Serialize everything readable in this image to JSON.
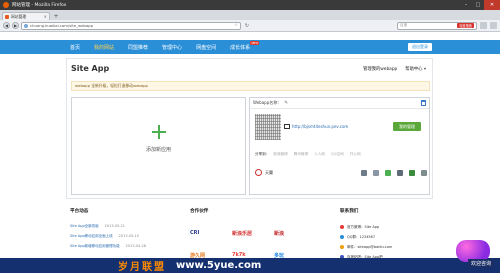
{
  "browser": {
    "window_title": "网站管理 - Mozilla Firefox",
    "tab_label": "网站管理",
    "tab_close": "×",
    "new_tab": "+",
    "back": "◀",
    "forward": "▶",
    "url": "chuang.kuaikai.com/site_webapp",
    "refresh": "↻",
    "search_placeholder": "百度",
    "search_badge": "百度搜索"
  },
  "site_nav": {
    "items": [
      {
        "label": "首页"
      },
      {
        "label": "我的网站"
      },
      {
        "label": "同盟推荐"
      },
      {
        "label": "管理中心"
      },
      {
        "label": "网盘空间"
      },
      {
        "label": "成长体系"
      }
    ],
    "hot_badge": "NEW",
    "user_button": "退出登录"
  },
  "main": {
    "page_title": "Site App",
    "manage_link": "管理我的webapp",
    "help_link": "帮助中心",
    "notice": "webapp 全新升级，轻松打造移动webapp",
    "add_label": "添加新应用",
    "app_card": {
      "name_label": "Webapp名称：",
      "url": "http://bjsmt4eshun.pev.com",
      "green_button": "我的管理",
      "share_label": "分享到：",
      "share_targets": [
        "新浪微博",
        "腾讯微博",
        "人人网",
        "QQ空间",
        "开心网"
      ],
      "owner": "天翼"
    }
  },
  "footer": {
    "news_title": "平台动态",
    "news": [
      {
        "title": "Site App全新改版",
        "date": "2013-05-21"
      },
      {
        "title": "Site App移动应用全面上线",
        "date": "2013-05-15"
      },
      {
        "title": "Site App新增移动应用管理功能",
        "date": "2013-04-28"
      }
    ],
    "partners_title": "合作伙伴",
    "partners": [
      {
        "name": "CRI",
        "color": "#2c3e8f"
      },
      {
        "name": "新浪乐居",
        "color": "#d32f2f"
      },
      {
        "name": "新浪",
        "color": "#c62828"
      },
      {
        "name": "游久网",
        "color": "#e67e22"
      },
      {
        "name": "7k7k",
        "color": "#e53935"
      },
      {
        "name": "多玩",
        "color": "#1e88e5"
      }
    ],
    "contact_title": "联系我们",
    "contacts": [
      {
        "label": "官方微博：Site App",
        "color": "#e53935"
      },
      {
        "label": "QQ群：1234567",
        "color": "#2b8fd8"
      },
      {
        "label": "邮件：siteapp@baidu.com",
        "color": "#f39c12"
      },
      {
        "label": "百度贴吧：Site App吧",
        "color": "#3f51b5"
      }
    ]
  },
  "watermark": {
    "text": "岁月联盟",
    "site": "www.5yue.com"
  },
  "welcome_badge": "欢迎咨询"
}
